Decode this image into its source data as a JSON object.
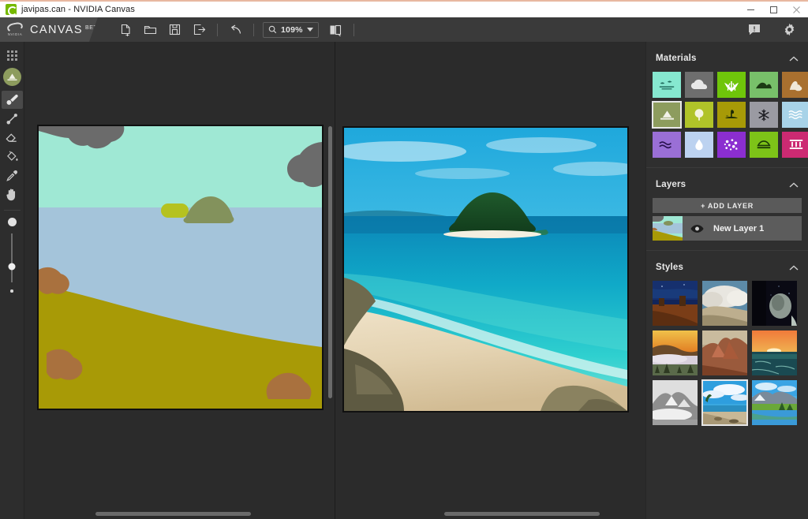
{
  "window": {
    "title": "javipas.can - NVIDIA Canvas",
    "logo_icon": "nvidia-eye-logo",
    "controls": [
      {
        "name": "minimize",
        "icon": "minimize-icon"
      },
      {
        "name": "maximize",
        "icon": "maximize-icon"
      },
      {
        "name": "close",
        "icon": "close-icon"
      }
    ]
  },
  "brand": {
    "wordmark": "NVIDIA",
    "app_name": "CANVAS",
    "badge": "BETA"
  },
  "toolbar": {
    "items": [
      {
        "name": "new-file",
        "icon": "new-file-icon",
        "label": "New"
      },
      {
        "name": "open-file",
        "icon": "open-folder-icon",
        "label": "Open"
      },
      {
        "name": "save-file",
        "icon": "save-disk-icon",
        "label": "Save"
      },
      {
        "name": "export-file",
        "icon": "export-icon",
        "label": "Export"
      },
      {
        "name": "undo",
        "icon": "undo-arrow-icon",
        "label": "Undo"
      },
      {
        "name": "split-view",
        "icon": "split-view-icon",
        "label": "Split View"
      }
    ],
    "zoom": {
      "icon": "magnifier-icon",
      "value": "109%",
      "chevron": "chevron-down-icon"
    },
    "right_items": [
      {
        "name": "feedback",
        "icon": "feedback-icon"
      },
      {
        "name": "settings",
        "icon": "gear-icon"
      }
    ]
  },
  "tool_rail": {
    "menu_icon": "dot-grid-icon",
    "current_material_icon": "mountain-icon",
    "current_material_color": "#8d9c5e",
    "tools": [
      {
        "name": "paintbrush",
        "icon": "paintbrush-icon",
        "active": true
      },
      {
        "name": "pen-line",
        "icon": "pen-line-icon",
        "active": false
      },
      {
        "name": "eraser",
        "icon": "eraser-icon",
        "active": false
      },
      {
        "name": "paint-bucket",
        "icon": "paint-bucket-icon",
        "active": false
      },
      {
        "name": "eyedropper",
        "icon": "eyedropper-icon",
        "active": false
      },
      {
        "name": "hand-pan",
        "icon": "hand-icon",
        "active": false
      }
    ],
    "brush_size": {
      "max_icon": "large-dot-icon",
      "min_icon": "small-dot-icon",
      "handle_position_pct": 68
    }
  },
  "canvas": {
    "sketch_pane_name": "segmentation-sketch",
    "render_pane_name": "ai-rendered-output",
    "background": "#2b2b2b",
    "sketch_colors": {
      "sky": "#9fe8d4",
      "cloud": "#6b6b6b",
      "water": "#a4c4da",
      "sand": "#a89a06",
      "rock": "#a9713e",
      "mountain": "#83925c",
      "bush": "#b5c220"
    }
  },
  "materials": {
    "title": "Materials",
    "collapse_icon": "chevron-up-icon",
    "items": [
      {
        "name": "sky",
        "icon": "birds-icon",
        "color": "#86e8d0",
        "glyph": "#1f6b5c",
        "selected": false
      },
      {
        "name": "cloud",
        "icon": "cloud-icon",
        "color": "#6e6e6e",
        "glyph": "#e8e8e8",
        "selected": false
      },
      {
        "name": "grass",
        "icon": "grass-icon",
        "color": "#6fc50a",
        "glyph": "#ffffff",
        "selected": false
      },
      {
        "name": "hill",
        "icon": "hill-icon",
        "color": "#78c06a",
        "glyph": "#1c3a14",
        "selected": false
      },
      {
        "name": "sand",
        "icon": "sand-icon",
        "color": "#a9702f",
        "glyph": "#f0e8d8",
        "selected": false
      },
      {
        "name": "mountain",
        "icon": "mountain-icon",
        "color": "#8d9c5e",
        "glyph": "#f2f2e8",
        "selected": true
      },
      {
        "name": "bush",
        "icon": "bush-icon",
        "color": "#b0c329",
        "glyph": "#f4f4e0",
        "selected": false
      },
      {
        "name": "tree",
        "icon": "tree-icon",
        "color": "#a79a07",
        "glyph": "#1d2a06",
        "selected": false
      },
      {
        "name": "snow",
        "icon": "snowflake-icon",
        "color": "#9a9aa2",
        "glyph": "#1c1c22",
        "selected": false
      },
      {
        "name": "water",
        "icon": "water-waves-icon",
        "color": "#a8d3e8",
        "glyph": "#ffffff",
        "selected": false
      },
      {
        "name": "river",
        "icon": "river-icon",
        "color": "#9a6fd6",
        "glyph": "#2a1250",
        "selected": false
      },
      {
        "name": "fog",
        "icon": "water-drop-icon",
        "color": "#bcd2f0",
        "glyph": "#ffffff",
        "selected": false
      },
      {
        "name": "flowers",
        "icon": "flowers-icon",
        "color": "#8b2ed0",
        "glyph": "#ffffff",
        "selected": false
      },
      {
        "name": "rock",
        "icon": "rock-dome-icon",
        "color": "#7dc318",
        "glyph": "#1b3a06",
        "selected": false
      },
      {
        "name": "ruins",
        "icon": "temple-icon",
        "color": "#cc2a72",
        "glyph": "#ffffff",
        "selected": false
      }
    ]
  },
  "layers": {
    "title": "Layers",
    "collapse_icon": "chevron-up-icon",
    "add_label": "+ ADD LAYER",
    "items": [
      {
        "name": "New Layer 1",
        "visible": true,
        "visibility_icon": "eye-icon"
      }
    ]
  },
  "styles": {
    "title": "Styles",
    "collapse_icon": "chevron-up-icon",
    "items": [
      {
        "name": "desert-night",
        "selected": false
      },
      {
        "name": "rocky-clouds",
        "selected": false
      },
      {
        "name": "dark-cave",
        "selected": false
      },
      {
        "name": "golden-sunset-fog",
        "selected": false
      },
      {
        "name": "red-canyon-peak",
        "selected": false
      },
      {
        "name": "ocean-sunset",
        "selected": false
      },
      {
        "name": "grey-snow-mountain",
        "selected": false
      },
      {
        "name": "tropical-beach",
        "selected": true
      },
      {
        "name": "alpine-lake",
        "selected": false
      }
    ]
  }
}
